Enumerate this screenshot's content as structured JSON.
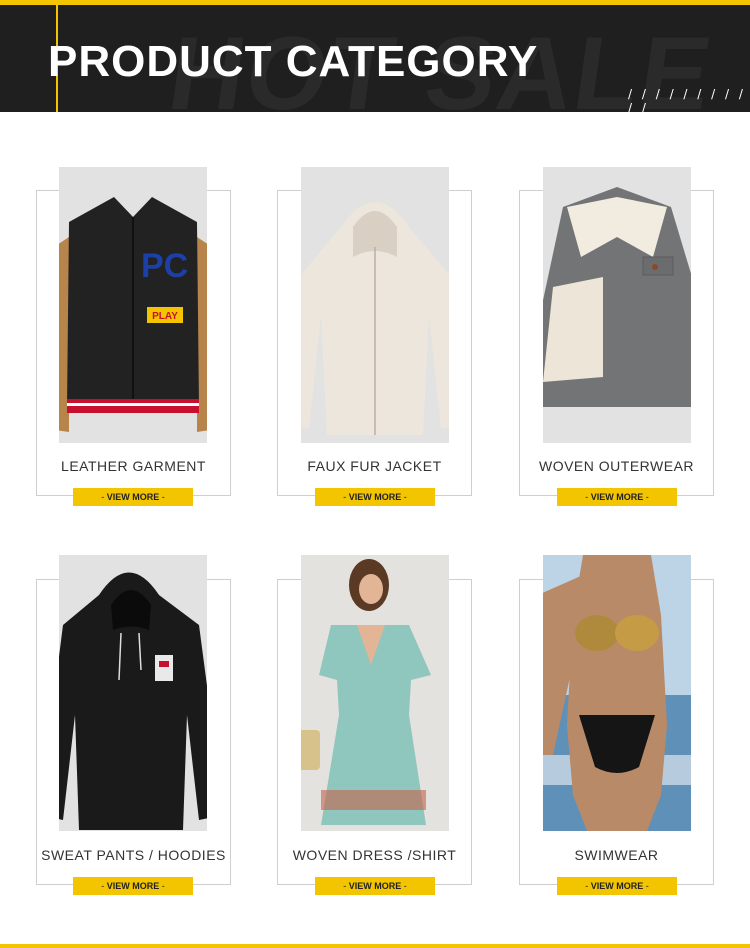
{
  "header": {
    "title": "PRODUCT CATEGORY",
    "background_text": "HOT SALE",
    "slashes": "/ / / / / / / / / / /"
  },
  "categories": [
    {
      "name": "LEATHER GARMENT",
      "button": "VIEW MORE",
      "image": "varsity-jacket"
    },
    {
      "name": "FAUX FUR JACKET",
      "button": "VIEW MORE",
      "image": "faux-fur-hoodie"
    },
    {
      "name": "WOVEN OUTERWEAR",
      "button": "VIEW MORE",
      "image": "corduroy-sherpa-jacket"
    },
    {
      "name": "SWEAT PANTS / HOODIES",
      "button": "VIEW MORE",
      "image": "black-hoodie"
    },
    {
      "name": "WOVEN DRESS /SHIRT",
      "button": "VIEW MORE",
      "image": "floral-wrap-dress"
    },
    {
      "name": "SWIMWEAR",
      "button": "VIEW MORE",
      "image": "gold-bikini"
    }
  ],
  "colors": {
    "accent": "#f2c500",
    "banner": "#1f1f1f",
    "photo_bg": "#e2e2e2"
  }
}
